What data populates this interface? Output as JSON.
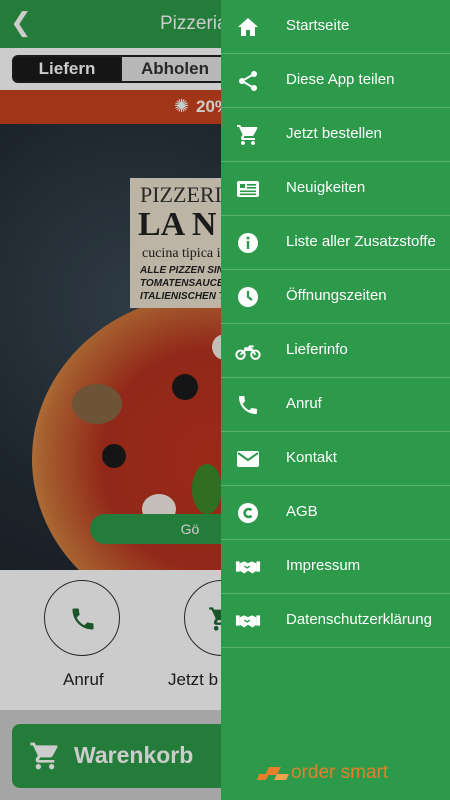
{
  "app_bar": {
    "title": "Pizzeria",
    "back_icon": "back-arrow-icon"
  },
  "tabs": {
    "active": "Liefern",
    "inactive": "Abholen"
  },
  "promo": {
    "text": "20%"
  },
  "poster": {
    "line1": "PIZZERIA",
    "line2": "LA N",
    "line3": "cucina tipica i",
    "line4": "ALLE PIZZEN SIN",
    "line5": "TOMATENSAUCE",
    "line6": "ITALIENISCHEN T"
  },
  "hero": {
    "button": "Gö"
  },
  "actions": [
    {
      "label": "Anruf",
      "icon": "phone-icon"
    },
    {
      "label": "Jetzt b",
      "icon": "cart-icon"
    }
  ],
  "cart_button": {
    "label": "Warenkorb",
    "icon": "cart-icon"
  },
  "drawer": {
    "items": [
      {
        "label": "Startseite",
        "icon": "home-icon"
      },
      {
        "label": "Diese App teilen",
        "icon": "share-icon"
      },
      {
        "label": "Jetzt bestellen",
        "icon": "cart-icon"
      },
      {
        "label": "Neuigkeiten",
        "icon": "news-icon"
      },
      {
        "label": "Liste aller Zusatzstoffe",
        "icon": "info-icon"
      },
      {
        "label": "Öffnungszeiten",
        "icon": "clock-icon"
      },
      {
        "label": "Lieferinfo",
        "icon": "motorcycle-icon"
      },
      {
        "label": "Anruf",
        "icon": "phone-icon"
      },
      {
        "label": "Kontakt",
        "icon": "mail-icon"
      },
      {
        "label": "AGB",
        "icon": "copyright-icon"
      },
      {
        "label": "Impressum",
        "icon": "handshake-icon"
      },
      {
        "label": "Datenschutzerklärung",
        "icon": "handshake-icon"
      }
    ],
    "brand": "order smart"
  },
  "colors": {
    "primary": "#2e9b49",
    "promo": "#c8441d",
    "brand": "#e87d2c"
  }
}
